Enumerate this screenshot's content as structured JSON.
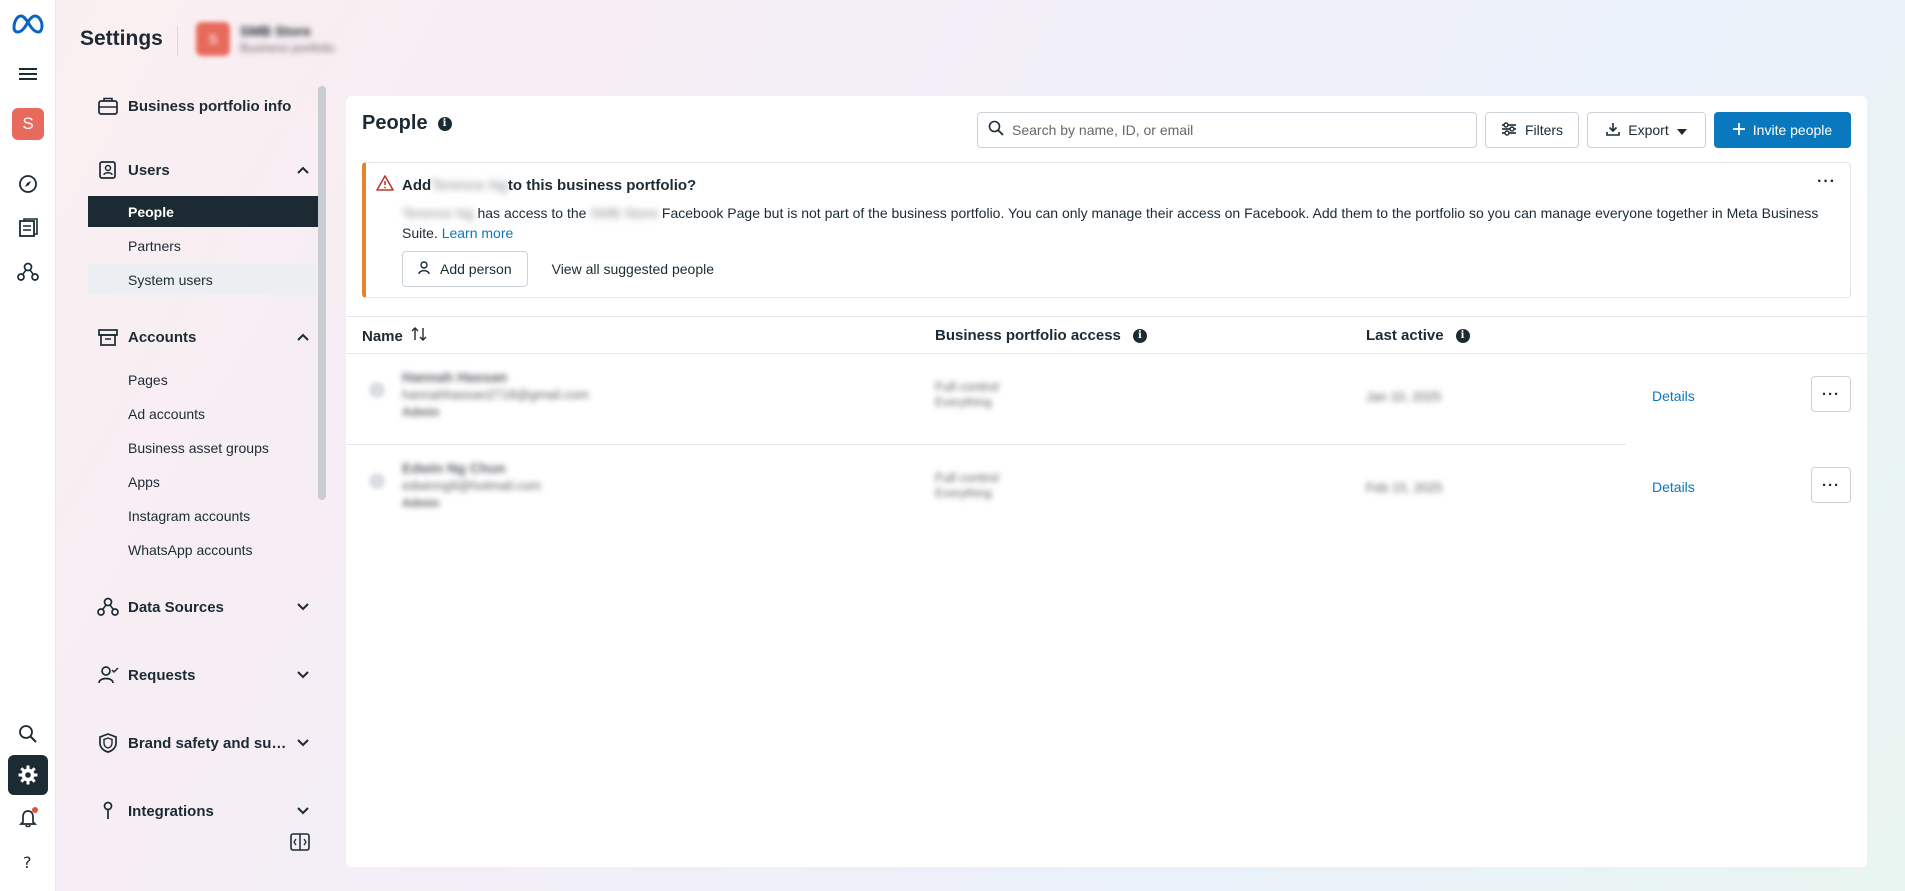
{
  "header": {
    "title": "Settings",
    "portfolio_initial": "S",
    "portfolio_name": "SMB Store",
    "portfolio_sub": "Business portfolio"
  },
  "rail": {
    "avatar_initial": "S"
  },
  "sidebar": {
    "business_info": "Business portfolio info",
    "users": {
      "label": "Users",
      "items": [
        "People",
        "Partners",
        "System users"
      ]
    },
    "accounts": {
      "label": "Accounts",
      "items": [
        "Pages",
        "Ad accounts",
        "Business asset groups",
        "Apps",
        "Instagram accounts",
        "WhatsApp accounts"
      ]
    },
    "data_sources": "Data Sources",
    "requests": "Requests",
    "brand_safety": "Brand safety and suitability",
    "integrations": "Integrations"
  },
  "main": {
    "title": "People",
    "search_placeholder": "Search by name, ID, or email",
    "filters_label": "Filters",
    "export_label": "Export",
    "invite_label": "Invite people",
    "banner": {
      "title_pre": "Add",
      "title_name": "Terence Ng",
      "title_post": "to this business portfolio?",
      "body_name": "Terence Ng",
      "body_1": "has access to the",
      "body_page": "SMB Store",
      "body_2": "Facebook Page but is not part of the business portfolio. You can only manage their access on Facebook. Add them to the portfolio so you can manage everyone together in Meta Business Suite.",
      "learn_more": "Learn more",
      "add_person": "Add person",
      "view_all": "View all suggested people"
    },
    "table": {
      "col_name": "Name",
      "col_access": "Business portfolio access",
      "col_last_active": "Last active",
      "rows": [
        {
          "name": "Hannah Hassan",
          "email": "hannahhassan2718@gmail.com",
          "tag": "Admin",
          "access": "Full control",
          "access_sub": "Everything",
          "last_active": "Jan 10, 2025",
          "details": "Details"
        },
        {
          "name": "Edwin Ng Chun",
          "email": "edwinng9@hotmail.com",
          "tag": "Admin",
          "access": "Full control",
          "access_sub": "Everything",
          "last_active": "Feb 15, 2025",
          "details": "Details"
        }
      ]
    }
  },
  "colors": {
    "accent": "#0a78be",
    "warning": "#e1852b",
    "dark": "#1c2b33",
    "avatar": "#e86a5c"
  }
}
